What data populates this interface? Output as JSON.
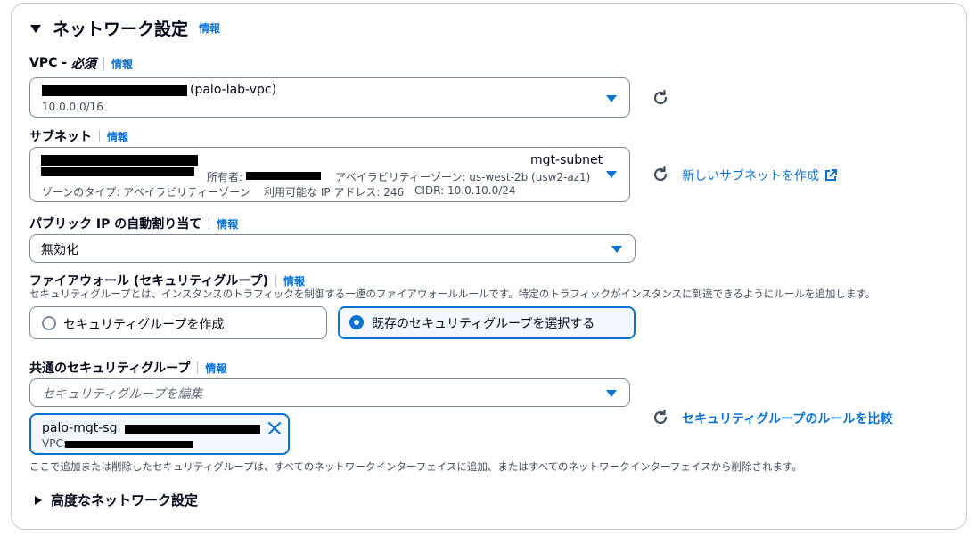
{
  "section": {
    "title": "ネットワーク設定",
    "info": "情報",
    "collapse_icon": "caret-down-icon"
  },
  "vpc": {
    "label": "VPC - ",
    "label_required": "必須",
    "info": "情報",
    "value_suffix": "(palo-lab-vpc)",
    "cidr": "10.0.0.0/16"
  },
  "subnet": {
    "label": "サブネット",
    "info": "情報",
    "name": "mgt-subnet",
    "owner_label": "所有者:",
    "az": "アベイラビリティーゾーン: us-west-2b (usw2-az1)",
    "zone_type": "ゾーンのタイプ: アベイラビリティーゾーン",
    "available_ips": "利用可能な IP アドレス: 246",
    "cidr": "CIDR: 10.0.10.0/24",
    "create_link": "新しいサブネットを作成"
  },
  "public_ip": {
    "label": "パブリック IP の自動割り当て",
    "info": "情報",
    "value": "無効化"
  },
  "firewall": {
    "label": "ファイアウォール (セキュリティグループ)",
    "info": "情報",
    "description": "セキュリティグループとは、インスタンスのトラフィックを制御する一連のファイアウォールルールです。特定のトラフィックがインスタンスに到達できるようにルールを追加します。",
    "option_create": "セキュリティグループを作成",
    "option_existing": "既存のセキュリティグループを選択する"
  },
  "common_sg": {
    "label": "共通のセキュリティグループ",
    "info": "情報",
    "placeholder": "セキュリティグループを編集",
    "token_name": "palo-mgt-sg",
    "token_vpc": "VPC:",
    "compare_link": "セキュリティグループのルールを比較",
    "footer": "ここで追加または削除したセキュリティグループは、すべてのネットワークインターフェイスに追加、またはすべてのネットワークインターフェイスから削除されます。"
  },
  "advanced": {
    "title": "高度なネットワーク設定",
    "expand_icon": "caret-right-icon"
  },
  "colors": {
    "accent": "#0972d3",
    "selected_bg": "#f2f8fd",
    "border": "#7d8998"
  }
}
